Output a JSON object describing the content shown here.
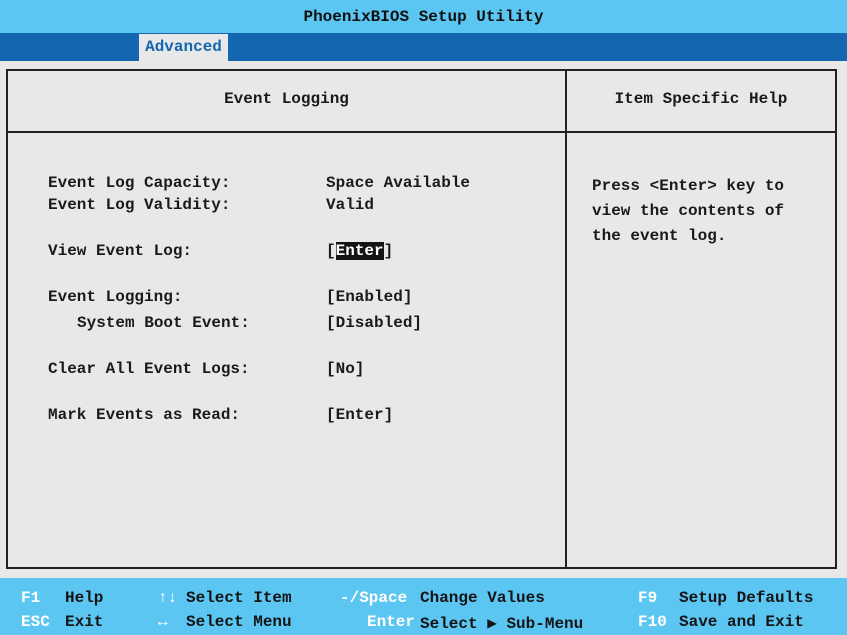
{
  "title": "PhoenixBIOS Setup Utility",
  "tabs": [
    {
      "label": "Advanced",
      "active": true
    }
  ],
  "main": {
    "header": "Event Logging",
    "items": [
      {
        "label": "Event Log Capacity:",
        "value": "Space Available"
      },
      {
        "label": "Event Log Validity:",
        "value": "Valid"
      },
      {
        "label": "View Event Log:",
        "value_prefix": "[",
        "value_selected": "Enter",
        "value_suffix": "]"
      },
      {
        "label": "Event Logging:",
        "value": "[Enabled]"
      },
      {
        "label": "System Boot Event:",
        "value": "[Disabled]"
      },
      {
        "label": "Clear All Event Logs:",
        "value": "[No]"
      },
      {
        "label": "Mark Events as Read:",
        "value": "[Enter]"
      }
    ]
  },
  "help": {
    "header": "Item Specific Help",
    "text": "Press <Enter> key to\nview the contents of\nthe event log."
  },
  "footer": [
    {
      "key": "F1",
      "action": "Help"
    },
    {
      "key": "ESC",
      "action": "Exit"
    },
    {
      "key": "↑↓",
      "action": "Select Item"
    },
    {
      "key": "↔",
      "action": "Select Menu"
    },
    {
      "key": "-/Space",
      "action": "Change Values"
    },
    {
      "key": "Enter",
      "action": "Select ▶ Sub-Menu"
    },
    {
      "key": "F9",
      "action": "Setup Defaults"
    },
    {
      "key": "F10",
      "action": "Save and Exit"
    }
  ],
  "colors": {
    "title_bar": "#5cc6f2",
    "tab_bar": "#1566b0",
    "background": "#e8e8e8",
    "selection": "#141414"
  }
}
